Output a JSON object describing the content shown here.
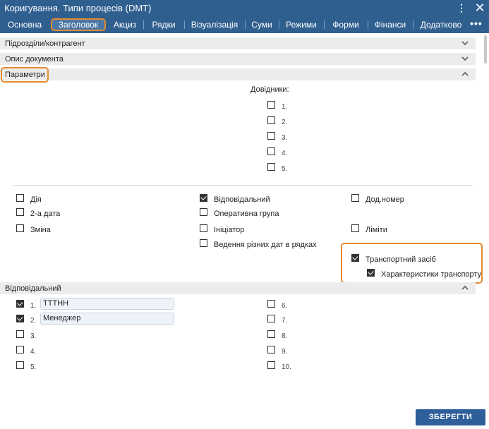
{
  "window": {
    "title": "Коригування. Типи процесів (DMT)"
  },
  "tabs": [
    "Основна",
    "Заголовок",
    "Акциз",
    "Рядки",
    "Візуалізація",
    "Суми",
    "Режими",
    "Форми",
    "Фінанси",
    "Додатково"
  ],
  "sections": {
    "subdivisions": "Підрозділи/контрагент",
    "doc_desc": "Опис документа",
    "params": "Параметри",
    "responsible": "Відповідальний"
  },
  "directories": {
    "title": "Довідники:",
    "items": [
      "1.",
      "2.",
      "3.",
      "4.",
      "5."
    ]
  },
  "params": {
    "action": "Дія",
    "date2": "2-а дата",
    "change": "Зміна",
    "responsible": "Відповідальний",
    "opgroup": "Оперативна група",
    "initiator": "Ініціатор",
    "diffdates": "Ведення різних дат в рядках",
    "addnum": "Дод.номер",
    "limits": "Ліміти",
    "vehicle": "Транспортний засіб",
    "vehicle_chars": "Характеристики транспорту"
  },
  "responsible_list": {
    "nums": [
      "1.",
      "2.",
      "3.",
      "4.",
      "5.",
      "6.",
      "7.",
      "8.",
      "9.",
      "10."
    ],
    "field1": "ТТТНН",
    "field2": "Менеджер"
  },
  "save_label": "ЗБЕРЕГТИ"
}
